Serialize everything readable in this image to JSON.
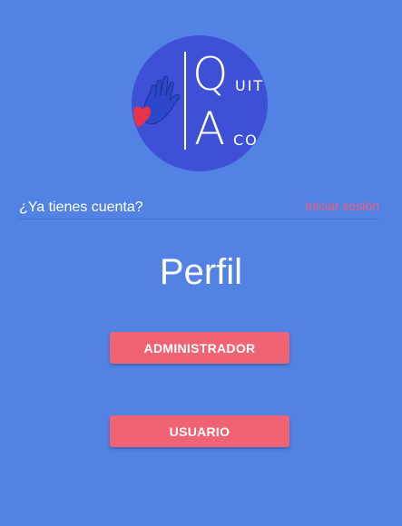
{
  "logo": {
    "letter_q": "Q",
    "letter_a": "A",
    "text_uit": "UIT",
    "text_co": "CO",
    "bg_color": "#3e50d6",
    "icons": [
      "hand-icon",
      "heart-icon"
    ]
  },
  "account": {
    "question": "¿Ya tienes cuenta?",
    "login_link": "Iniciar sesión"
  },
  "page": {
    "title": "Perfil"
  },
  "roles": {
    "admin_label": "ADMINISTRADOR",
    "user_label": "USUARIO"
  },
  "colors": {
    "background": "#5283e4",
    "accent": "#f06375",
    "link": "#f0617a"
  }
}
